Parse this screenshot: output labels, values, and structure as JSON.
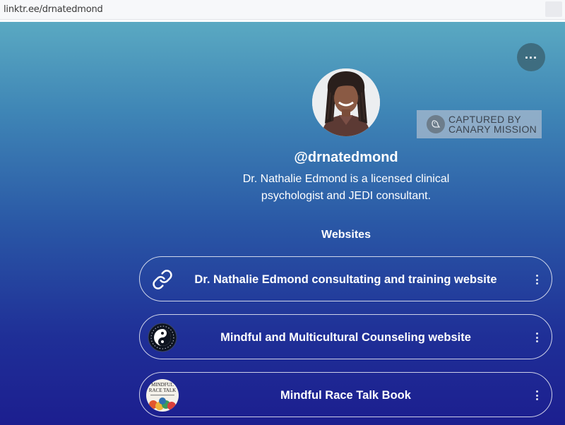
{
  "browser": {
    "url": "linktr.ee/drnatedmond"
  },
  "profile": {
    "handle": "@drnatedmond",
    "bio": "Dr. Nathalie Edmond is a licensed clinical psychologist and JEDI consultant."
  },
  "watermark": {
    "line1": "CAPTURED BY",
    "line2": "CANARY MISSION"
  },
  "menu": {
    "more_label": "..."
  },
  "section": {
    "title": "Websites"
  },
  "links": [
    {
      "label": "Dr. Nathalie Edmond consultating and training website",
      "icon": "link-icon"
    },
    {
      "label": "Mindful and Multicultural Counseling website",
      "icon": "yin-yang-logo"
    },
    {
      "label": "Mindful Race Talk Book",
      "icon": "book-cover-thumbnail"
    }
  ],
  "book_thumb": {
    "line1": "MINDFUL",
    "line2": "RACE TALK"
  },
  "colors": {
    "gradient_top": "#5aa9c2",
    "gradient_bottom": "#1c1e8f",
    "more_button": "#3e6d80",
    "text": "#ffffff"
  }
}
